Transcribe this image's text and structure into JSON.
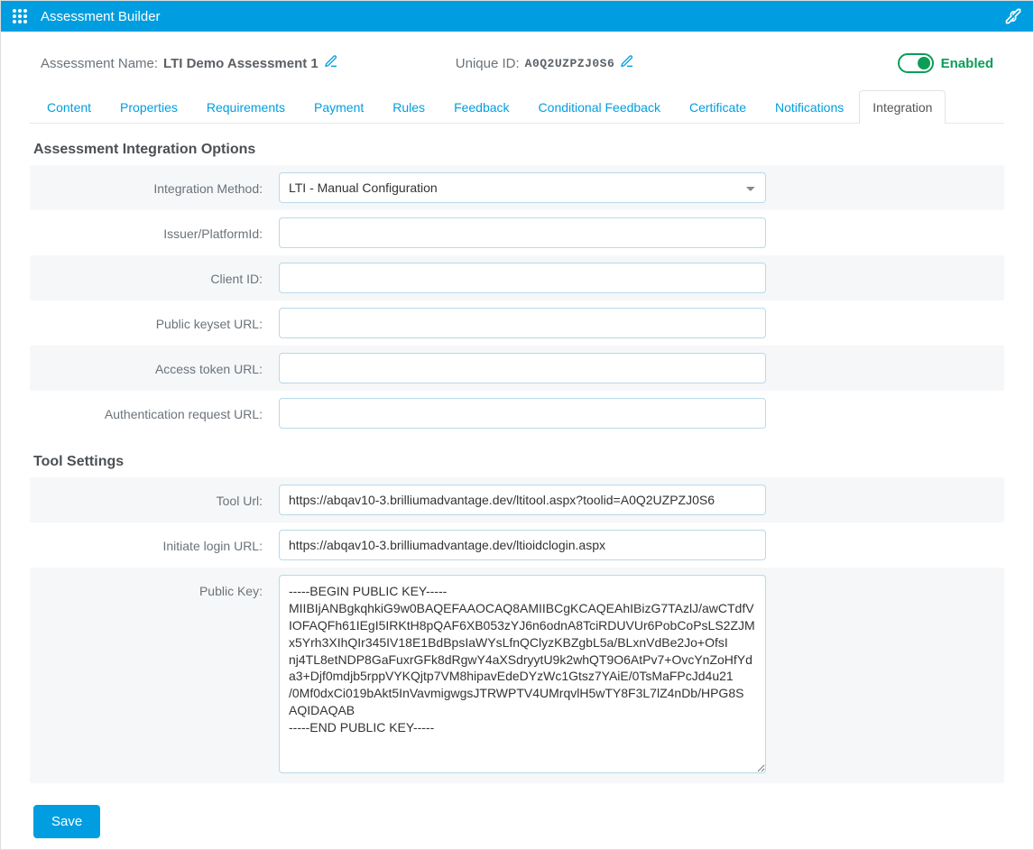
{
  "titlebar": {
    "title": "Assessment Builder"
  },
  "header": {
    "name_label": "Assessment Name:",
    "name_value": "LTI Demo Assessment 1",
    "uid_label": "Unique ID:",
    "uid_value": "A0Q2UZPZJ0S6",
    "enabled_label": "Enabled"
  },
  "tabs": {
    "items": [
      "Content",
      "Properties",
      "Requirements",
      "Payment",
      "Rules",
      "Feedback",
      "Conditional Feedback",
      "Certificate",
      "Notifications",
      "Integration"
    ],
    "active_index": 9
  },
  "sections": {
    "integration_title": "Assessment Integration Options",
    "tool_title": "Tool Settings"
  },
  "fields": {
    "integration_method": {
      "label": "Integration Method:",
      "value": "LTI - Manual Configuration"
    },
    "issuer": {
      "label": "Issuer/PlatformId:",
      "value": ""
    },
    "client_id": {
      "label": "Client ID:",
      "value": ""
    },
    "keyset_url": {
      "label": "Public keyset URL:",
      "value": ""
    },
    "token_url": {
      "label": "Access token URL:",
      "value": ""
    },
    "auth_url": {
      "label": "Authentication request URL:",
      "value": ""
    },
    "tool_url": {
      "label": "Tool Url:",
      "value": "https://abqav10-3.brilliumadvantage.dev/ltitool.aspx?toolid=A0Q2UZPZJ0S6"
    },
    "login_url": {
      "label": "Initiate login URL:",
      "value": "https://abqav10-3.brilliumadvantage.dev/ltioidclogin.aspx"
    },
    "public_key": {
      "label": "Public Key:",
      "value": "-----BEGIN PUBLIC KEY-----\nMIIBIjANBgkqhkiG9w0BAQEFAAOCAQ8AMIIBCgKCAQEAhIBizG7TAzlJ/awCTdfV\nIOFAQFh61IEgI5IRKtH8pQAF6XB053zYJ6n6odnA8TciRDUVUr6PobCoPsLS2ZJM\nx5Yrh3XIhQIr345IV18E1BdBpsIaWYsLfnQClyzKBZgbL5a/BLxnVdBe2Jo+OfsI\nnj4TL8etNDP8GaFuxrGFk8dRgwY4aXSdryytU9k2whQT9O6AtPv7+OvcYnZoHfYd\na3+Djf0mdjb5rppVYKQjtp7VM8hipavEdeDYzWc1Gtsz7YAiE/0TsMaFPcJd4u21\n/0Mf0dxCi019bAkt5InVavmigwgsJTRWPTV4UMrqvlH5wTY8F3L7lZ4nDb/HPG8S\nAQIDAQAB\n-----END PUBLIC KEY-----"
    }
  },
  "buttons": {
    "save": "Save"
  }
}
